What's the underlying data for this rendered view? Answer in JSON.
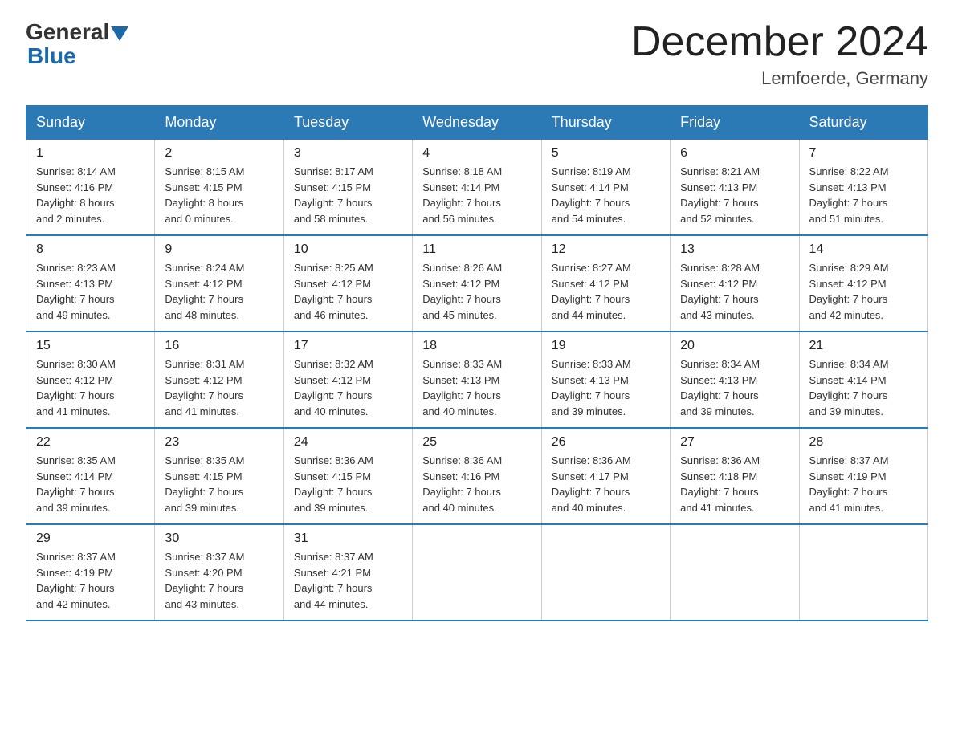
{
  "logo": {
    "general": "General",
    "blue": "Blue"
  },
  "header": {
    "title": "December 2024",
    "subtitle": "Lemfoerde, Germany"
  },
  "weekdays": [
    "Sunday",
    "Monday",
    "Tuesday",
    "Wednesday",
    "Thursday",
    "Friday",
    "Saturday"
  ],
  "weeks": [
    [
      {
        "day": "1",
        "sunrise": "Sunrise: 8:14 AM",
        "sunset": "Sunset: 4:16 PM",
        "daylight": "Daylight: 8 hours",
        "daylight2": "and 2 minutes."
      },
      {
        "day": "2",
        "sunrise": "Sunrise: 8:15 AM",
        "sunset": "Sunset: 4:15 PM",
        "daylight": "Daylight: 8 hours",
        "daylight2": "and 0 minutes."
      },
      {
        "day": "3",
        "sunrise": "Sunrise: 8:17 AM",
        "sunset": "Sunset: 4:15 PM",
        "daylight": "Daylight: 7 hours",
        "daylight2": "and 58 minutes."
      },
      {
        "day": "4",
        "sunrise": "Sunrise: 8:18 AM",
        "sunset": "Sunset: 4:14 PM",
        "daylight": "Daylight: 7 hours",
        "daylight2": "and 56 minutes."
      },
      {
        "day": "5",
        "sunrise": "Sunrise: 8:19 AM",
        "sunset": "Sunset: 4:14 PM",
        "daylight": "Daylight: 7 hours",
        "daylight2": "and 54 minutes."
      },
      {
        "day": "6",
        "sunrise": "Sunrise: 8:21 AM",
        "sunset": "Sunset: 4:13 PM",
        "daylight": "Daylight: 7 hours",
        "daylight2": "and 52 minutes."
      },
      {
        "day": "7",
        "sunrise": "Sunrise: 8:22 AM",
        "sunset": "Sunset: 4:13 PM",
        "daylight": "Daylight: 7 hours",
        "daylight2": "and 51 minutes."
      }
    ],
    [
      {
        "day": "8",
        "sunrise": "Sunrise: 8:23 AM",
        "sunset": "Sunset: 4:13 PM",
        "daylight": "Daylight: 7 hours",
        "daylight2": "and 49 minutes."
      },
      {
        "day": "9",
        "sunrise": "Sunrise: 8:24 AM",
        "sunset": "Sunset: 4:12 PM",
        "daylight": "Daylight: 7 hours",
        "daylight2": "and 48 minutes."
      },
      {
        "day": "10",
        "sunrise": "Sunrise: 8:25 AM",
        "sunset": "Sunset: 4:12 PM",
        "daylight": "Daylight: 7 hours",
        "daylight2": "and 46 minutes."
      },
      {
        "day": "11",
        "sunrise": "Sunrise: 8:26 AM",
        "sunset": "Sunset: 4:12 PM",
        "daylight": "Daylight: 7 hours",
        "daylight2": "and 45 minutes."
      },
      {
        "day": "12",
        "sunrise": "Sunrise: 8:27 AM",
        "sunset": "Sunset: 4:12 PM",
        "daylight": "Daylight: 7 hours",
        "daylight2": "and 44 minutes."
      },
      {
        "day": "13",
        "sunrise": "Sunrise: 8:28 AM",
        "sunset": "Sunset: 4:12 PM",
        "daylight": "Daylight: 7 hours",
        "daylight2": "and 43 minutes."
      },
      {
        "day": "14",
        "sunrise": "Sunrise: 8:29 AM",
        "sunset": "Sunset: 4:12 PM",
        "daylight": "Daylight: 7 hours",
        "daylight2": "and 42 minutes."
      }
    ],
    [
      {
        "day": "15",
        "sunrise": "Sunrise: 8:30 AM",
        "sunset": "Sunset: 4:12 PM",
        "daylight": "Daylight: 7 hours",
        "daylight2": "and 41 minutes."
      },
      {
        "day": "16",
        "sunrise": "Sunrise: 8:31 AM",
        "sunset": "Sunset: 4:12 PM",
        "daylight": "Daylight: 7 hours",
        "daylight2": "and 41 minutes."
      },
      {
        "day": "17",
        "sunrise": "Sunrise: 8:32 AM",
        "sunset": "Sunset: 4:12 PM",
        "daylight": "Daylight: 7 hours",
        "daylight2": "and 40 minutes."
      },
      {
        "day": "18",
        "sunrise": "Sunrise: 8:33 AM",
        "sunset": "Sunset: 4:13 PM",
        "daylight": "Daylight: 7 hours",
        "daylight2": "and 40 minutes."
      },
      {
        "day": "19",
        "sunrise": "Sunrise: 8:33 AM",
        "sunset": "Sunset: 4:13 PM",
        "daylight": "Daylight: 7 hours",
        "daylight2": "and 39 minutes."
      },
      {
        "day": "20",
        "sunrise": "Sunrise: 8:34 AM",
        "sunset": "Sunset: 4:13 PM",
        "daylight": "Daylight: 7 hours",
        "daylight2": "and 39 minutes."
      },
      {
        "day": "21",
        "sunrise": "Sunrise: 8:34 AM",
        "sunset": "Sunset: 4:14 PM",
        "daylight": "Daylight: 7 hours",
        "daylight2": "and 39 minutes."
      }
    ],
    [
      {
        "day": "22",
        "sunrise": "Sunrise: 8:35 AM",
        "sunset": "Sunset: 4:14 PM",
        "daylight": "Daylight: 7 hours",
        "daylight2": "and 39 minutes."
      },
      {
        "day": "23",
        "sunrise": "Sunrise: 8:35 AM",
        "sunset": "Sunset: 4:15 PM",
        "daylight": "Daylight: 7 hours",
        "daylight2": "and 39 minutes."
      },
      {
        "day": "24",
        "sunrise": "Sunrise: 8:36 AM",
        "sunset": "Sunset: 4:15 PM",
        "daylight": "Daylight: 7 hours",
        "daylight2": "and 39 minutes."
      },
      {
        "day": "25",
        "sunrise": "Sunrise: 8:36 AM",
        "sunset": "Sunset: 4:16 PM",
        "daylight": "Daylight: 7 hours",
        "daylight2": "and 40 minutes."
      },
      {
        "day": "26",
        "sunrise": "Sunrise: 8:36 AM",
        "sunset": "Sunset: 4:17 PM",
        "daylight": "Daylight: 7 hours",
        "daylight2": "and 40 minutes."
      },
      {
        "day": "27",
        "sunrise": "Sunrise: 8:36 AM",
        "sunset": "Sunset: 4:18 PM",
        "daylight": "Daylight: 7 hours",
        "daylight2": "and 41 minutes."
      },
      {
        "day": "28",
        "sunrise": "Sunrise: 8:37 AM",
        "sunset": "Sunset: 4:19 PM",
        "daylight": "Daylight: 7 hours",
        "daylight2": "and 41 minutes."
      }
    ],
    [
      {
        "day": "29",
        "sunrise": "Sunrise: 8:37 AM",
        "sunset": "Sunset: 4:19 PM",
        "daylight": "Daylight: 7 hours",
        "daylight2": "and 42 minutes."
      },
      {
        "day": "30",
        "sunrise": "Sunrise: 8:37 AM",
        "sunset": "Sunset: 4:20 PM",
        "daylight": "Daylight: 7 hours",
        "daylight2": "and 43 minutes."
      },
      {
        "day": "31",
        "sunrise": "Sunrise: 8:37 AM",
        "sunset": "Sunset: 4:21 PM",
        "daylight": "Daylight: 7 hours",
        "daylight2": "and 44 minutes."
      },
      null,
      null,
      null,
      null
    ]
  ]
}
